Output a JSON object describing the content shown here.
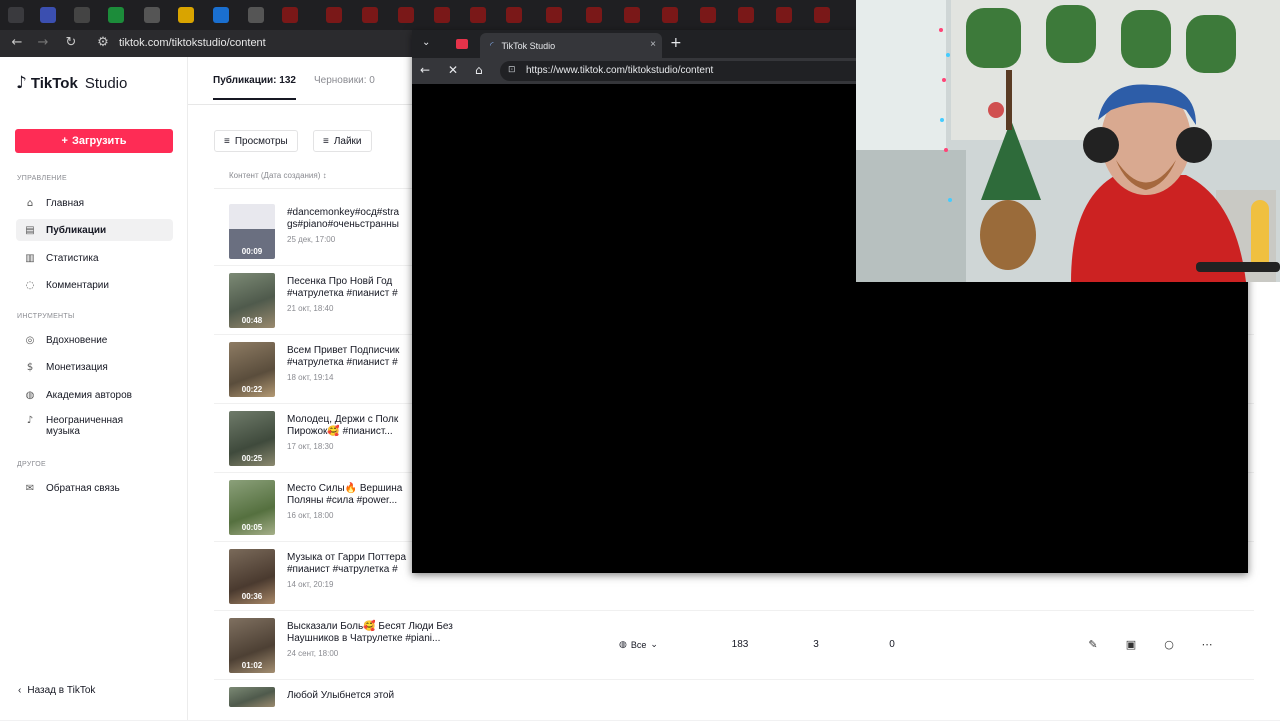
{
  "browser_back": {
    "url": "tiktok.com/tiktokstudio/content"
  },
  "browser_front": {
    "tab_title": "TikTok Studio",
    "url": "https://www.tiktok.com/tiktokstudio/content",
    "new_tab_symbol": "+",
    "close_symbol": "×"
  },
  "sidebar": {
    "logo": "TikTok",
    "logo_sub": "Studio",
    "upload_label": "Загрузить",
    "sections": {
      "manage": "УПРАВЛЕНИЕ",
      "tools": "ИНСТРУМЕНТЫ",
      "other": "ДРУГОЕ"
    },
    "items": [
      {
        "label": "Главная",
        "icon": "home-icon"
      },
      {
        "label": "Публикации",
        "icon": "posts-icon"
      },
      {
        "label": "Статистика",
        "icon": "stats-icon"
      },
      {
        "label": "Комментарии",
        "icon": "comments-icon"
      },
      {
        "label": "Вдохновение",
        "icon": "lightbulb-icon"
      },
      {
        "label": "Монетизация",
        "icon": "money-icon"
      },
      {
        "label": "Академия авторов",
        "icon": "academy-icon"
      },
      {
        "label": "Неограниченная\nмузыка",
        "icon": "music-icon"
      },
      {
        "label": "Обратная связь",
        "icon": "feedback-icon"
      }
    ],
    "back_label": "Назад в TikTok"
  },
  "main": {
    "tab_published": "Публикации: 132",
    "tab_drafts": "Черновики: 0",
    "filters": [
      "Просмотры",
      "Лайки"
    ],
    "column_header": "Контент (Дата создания)",
    "rows": [
      {
        "title": "#dancemonkey#осд#stra\ngs#piano#оченьстранны",
        "date": "25 дек, 17:00",
        "duration": "00:09"
      },
      {
        "title": "Песенка Про Новй Год \n#чатрулетка #пианист #",
        "date": "21 окт, 18:40",
        "duration": "00:48"
      },
      {
        "title": "Всем Привет Подписчик\n#чатрулетка #пианист #",
        "date": "18 окт, 19:14",
        "duration": "00:22"
      },
      {
        "title": "Молодец, Держи с Полк\nПирожок🥰 #пианист...",
        "date": "17 окт, 18:30",
        "duration": "00:25"
      },
      {
        "title": "Место Силы🔥 Вершина\nПоляны #сила #power...",
        "date": "16 окт, 18:00",
        "duration": "00:05"
      },
      {
        "title": "Музыка от Гарри Поттера\n#пианист #чатрулетка #",
        "date": "14 окт, 20:19",
        "duration": "00:36"
      },
      {
        "title": "Высказали Боль🥰 Бесят Люди Без\nНаушников в Чатрулетке #piani...",
        "date": "24 сент, 18:00",
        "duration": "01:02",
        "privacy": "Все",
        "views": "183",
        "likes": "3",
        "comments": "0"
      },
      {
        "title": "Любой Улыбнется этой",
        "date": "",
        "duration": ""
      }
    ]
  }
}
